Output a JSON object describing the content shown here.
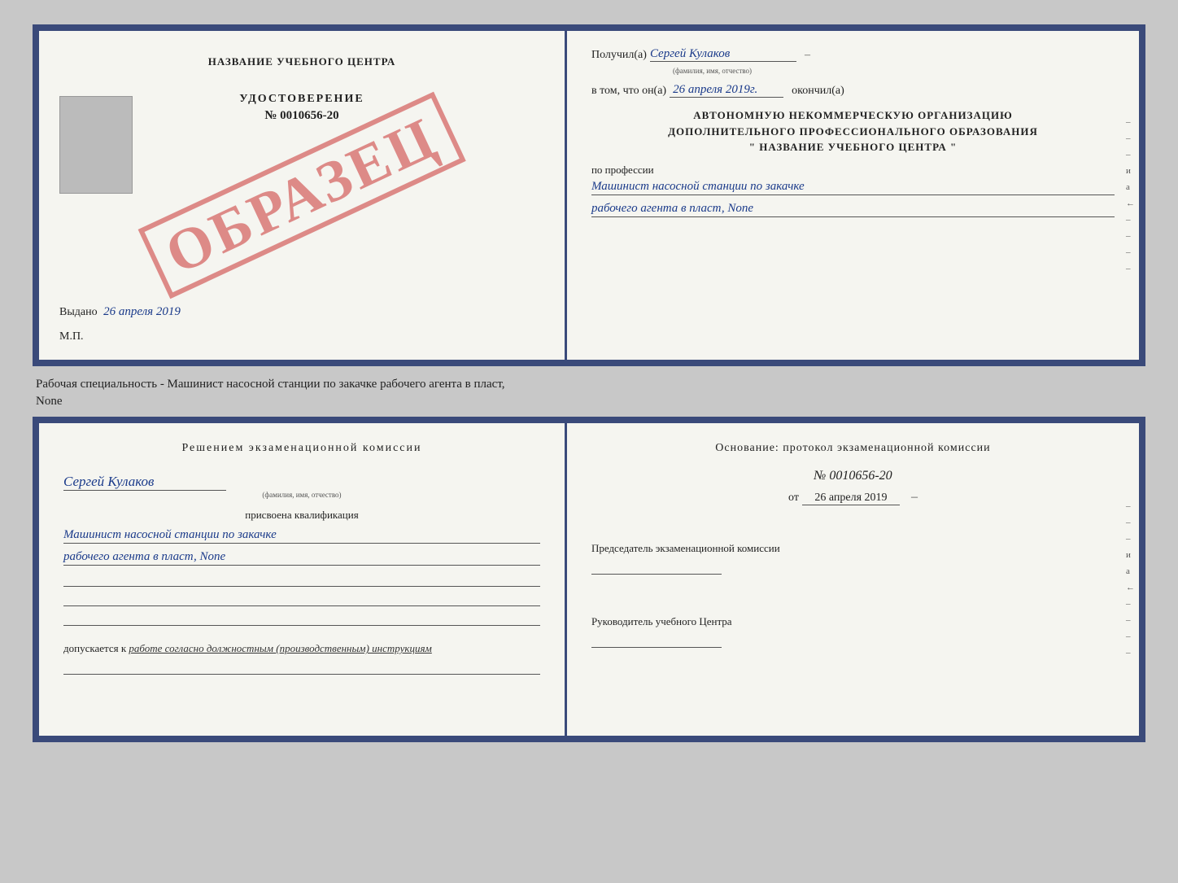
{
  "top_left": {
    "center_name": "НАЗВАНИЕ УЧЕБНОГО ЦЕНТРА",
    "udostoverenie_label": "УДОСТОВЕРЕНИЕ",
    "number": "№ 0010656-20",
    "vydano_label": "Выдано",
    "vydano_date": "26 апреля 2019",
    "mp": "М.П.",
    "stamp": "ОБРАЗЕЦ"
  },
  "top_right": {
    "poluchil_label": "Получил(а)",
    "poluchil_value": "Сергей Кулаков",
    "poluchil_hint": "(фамилия, имя, отчество)",
    "vtom_label": "в том, что он(а)",
    "vtom_value": "26 апреля 2019г.",
    "okonchil_label": "окончил(а)",
    "org_line1": "АВТОНОМНУЮ НЕКОММЕРЧЕСКУЮ ОРГАНИЗАЦИЮ",
    "org_line2": "ДОПОЛНИТЕЛЬНОГО ПРОФЕССИОНАЛЬНОГО ОБРАЗОВАНИЯ",
    "org_line3": "\" НАЗВАНИЕ УЧЕБНОГО ЦЕНТРА \"",
    "po_professii": "по профессии",
    "profession_line1": "Машинист насосной станции по закачке",
    "profession_line2": "рабочего агента в пласт, None"
  },
  "between": {
    "text_line1": "Рабочая специальность - Машинист насосной станции по закачке рабочего агента в пласт,",
    "text_line2": "None"
  },
  "bottom_left": {
    "title": "Решением  экзаменационной  комиссии",
    "person_name": "Сергей Кулаков",
    "person_hint": "(фамилия, имя, отчество)",
    "prisvoena": "присвоена квалификация",
    "qual_line1": "Машинист насосной станции по закачке",
    "qual_line2": "рабочего агента в пласт, None",
    "dopuskaetsya_label": "допускается к",
    "dopuskaetsya_value": "работе согласно должностным (производственным) инструкциям"
  },
  "bottom_right": {
    "osnovanie_title": "Основание:  протокол  экзаменационной  комиссии",
    "protocol_number": "№  0010656-20",
    "ot_label": "от",
    "ot_date": "26 апреля 2019",
    "predsedatel_label": "Председатель экзаменационной комиссии",
    "rukovoditel_label": "Руководитель учебного Центра"
  }
}
